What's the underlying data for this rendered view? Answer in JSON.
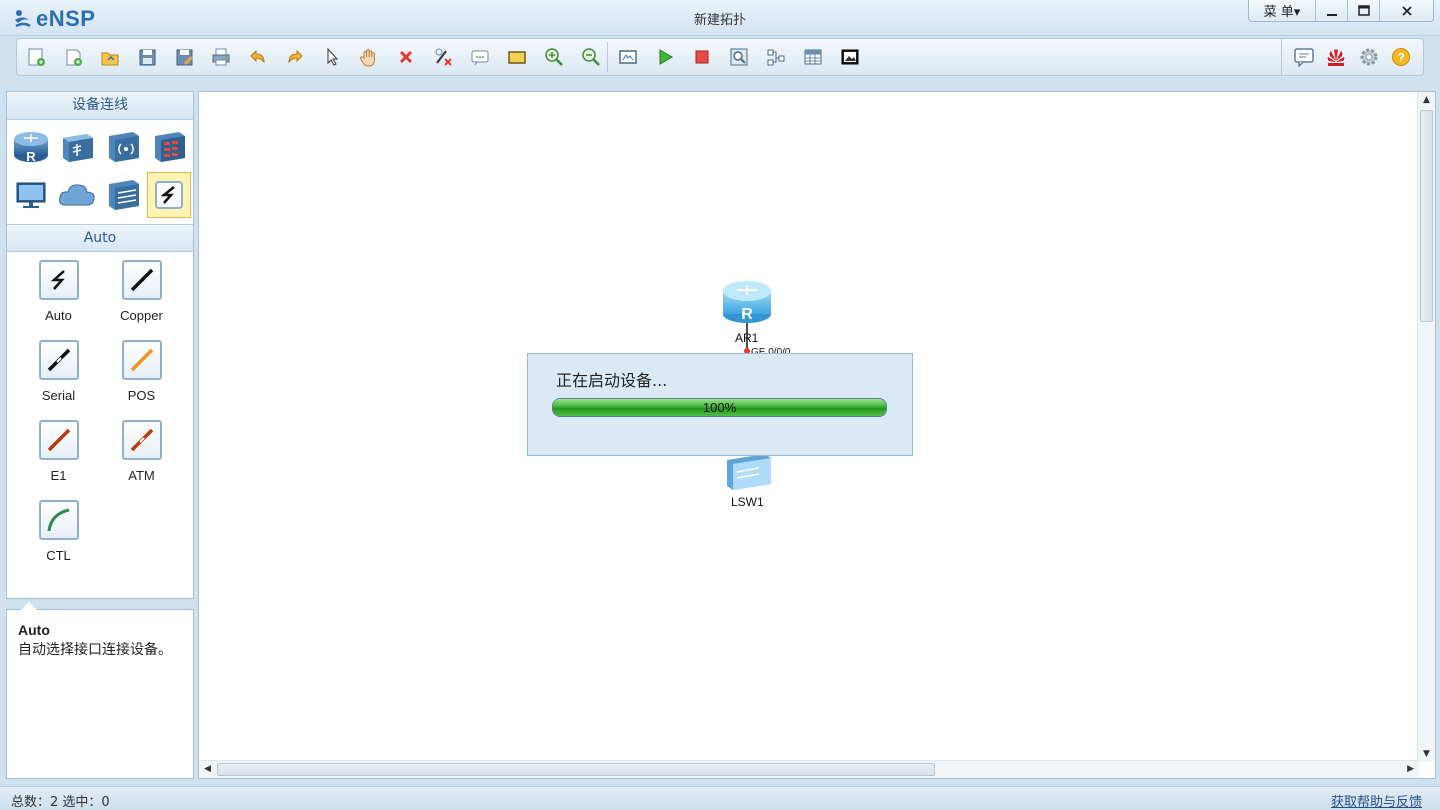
{
  "app": {
    "name": "eNSP",
    "window_title": "新建拓扑"
  },
  "window_controls": {
    "menu_label": "菜 单▾",
    "minimize": "–",
    "maximize": "□",
    "close": "✕"
  },
  "toolbar": {
    "tools": [
      "new-topology-icon",
      "new-example-icon",
      "open-icon",
      "save-icon",
      "save-as-icon",
      "print-icon",
      "undo-icon",
      "redo-icon",
      "select-pointer-icon",
      "pan-hand-icon",
      "delete-icon",
      "delete-all-links-icon",
      "text-label-icon",
      "palette-icon",
      "zoom-in-icon",
      "zoom-out-icon",
      "fit-screen-icon",
      "start-device-icon",
      "stop-device-icon",
      "capture-icon",
      "topology-icon",
      "grid-icon",
      "screenshot-icon"
    ],
    "right_tools": [
      "chat-icon",
      "huawei-logo-icon",
      "settings-icon",
      "help-icon"
    ]
  },
  "device_panel": {
    "title": "设备连线",
    "devices": [
      "router-icon",
      "switch-icon",
      "wlan-icon",
      "firewall-icon",
      "pc-icon",
      "cloud-icon",
      "other-device-icon",
      "auto-link-icon"
    ],
    "selected_device_index": 7
  },
  "cable_panel": {
    "title": "Auto",
    "cables": [
      {
        "label": "Auto",
        "color": "#111111",
        "icon": "auto-cable-icon"
      },
      {
        "label": "Copper",
        "color": "#111111",
        "icon": "copper-cable-icon"
      },
      {
        "label": "Serial",
        "color": "#111111",
        "icon": "serial-cable-icon"
      },
      {
        "label": "POS",
        "color": "#f29325",
        "icon": "pos-cable-icon"
      },
      {
        "label": "E1",
        "color": "#b83a12",
        "icon": "e1-cable-icon"
      },
      {
        "label": "ATM",
        "color": "#b83a12",
        "icon": "atm-cable-icon"
      },
      {
        "label": "CTL",
        "color": "#2f8a52",
        "icon": "ctl-cable-icon"
      }
    ]
  },
  "description": {
    "title": "Auto",
    "text": "自动选择接口连接设备。"
  },
  "canvas": {
    "nodes": [
      {
        "label": "AR1",
        "type": "router"
      },
      {
        "label": "LSW1",
        "type": "switch"
      }
    ],
    "port_label": "GE 0/0/0"
  },
  "dialog": {
    "message": "正在启动设备...",
    "progress": 1.0,
    "progress_text": "100%"
  },
  "status": {
    "left": "总数：2  选中：0",
    "help_link": "获取帮助与反馈"
  }
}
